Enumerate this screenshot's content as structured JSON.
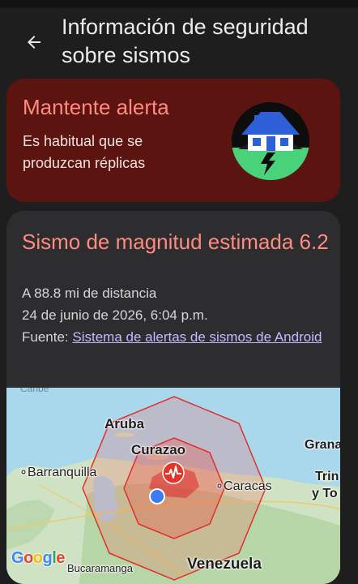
{
  "header": {
    "title": "Información de seguridad sobre sismos",
    "back_icon": "arrow-left-icon"
  },
  "alert": {
    "title": "Mantente alerta",
    "text": "Es habitual que se produzcan réplicas",
    "illustration": "house-earthquake-icon",
    "card_color": "#5c1411",
    "title_color": "#ff8a80"
  },
  "quake": {
    "title": "Sismo de magnitud estimada 6.2",
    "distance": "A 88.8 mi de distancia",
    "date": "24 de junio de 2026, 6:04 p.m.",
    "source_prefix": "Fuente: ",
    "source_link": "Sistema de alertas de sismos de Android"
  },
  "map": {
    "labels": {
      "caribe": "Caribe",
      "aruba": "Aruba",
      "curazao": "Curazao",
      "barranquilla": "Barranquilla",
      "caracas": "Caracas",
      "granada": "Grana",
      "trinidad_1": "Trin",
      "trinidad_2": "y To",
      "bucaramanga": "Bucaramanga",
      "venezuela": "Venezuela"
    },
    "google": [
      "G",
      "o",
      "o",
      "g",
      "l",
      "e"
    ],
    "epicenter_icon": "seismic-wave-icon",
    "user_location_icon": "location-dot-icon"
  }
}
